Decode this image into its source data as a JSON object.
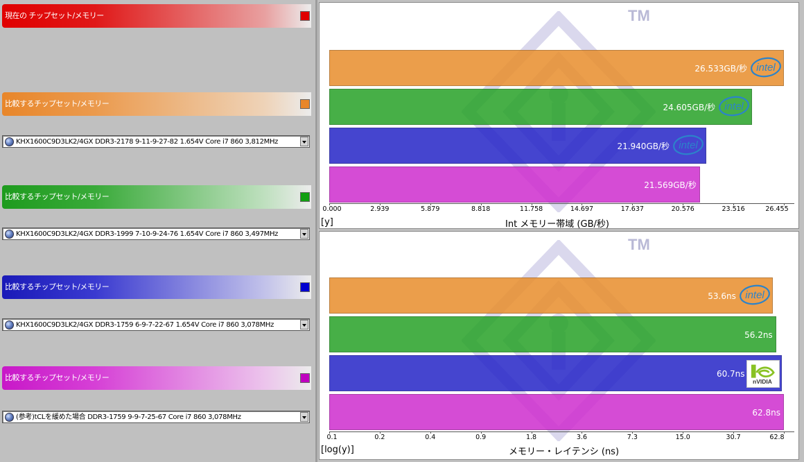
{
  "sidebar": {
    "current_label": "現在の チップセット/メモリー",
    "compare_label": "比較するチップセット/メモリー",
    "slots": [
      {
        "label": "比較するチップセット/メモリー",
        "select_value": "KHX1600C9D3LK2/4GX DDR3-2178 9-11-9-27-82 1.654V Core i7 860 3,812MHz",
        "color": "#e88f2e"
      },
      {
        "label": "比較するチップセット/メモリー",
        "select_value": "KHX1600C9D3LK2/4GX DDR3-1999 7-10-9-24-76 1.654V Core i7 860  3,497MHz",
        "color": "#29a329"
      },
      {
        "label": "比較するチップセット/メモリー",
        "select_value": "KHX1600C9D3LK2/4GX DDR3-1759 6-9-7-22-67 1.654V Core i7 860 3,078MHz",
        "color": "#2727c8"
      },
      {
        "label": "比較するチップセット/メモリー",
        "select_value": "(参考)tCLを緩めた場合  DDR3-1759 9-9-7-25-67 Core i7 860 3,078MHz",
        "color": "#cf2fcf"
      }
    ]
  },
  "watermark": {
    "tm": "TM"
  },
  "chart_data": [
    {
      "type": "bar",
      "orientation": "horizontal",
      "xlabel": "Int メモリー帯域 (GB/秒)",
      "ylabel": "[y]",
      "xlim": [
        0,
        26.455
      ],
      "ticks": [
        "0.000",
        "2.939",
        "5.879",
        "8.818",
        "11.758",
        "14.697",
        "17.637",
        "20.576",
        "23.516",
        "26.455"
      ],
      "values": [
        26.533,
        24.605,
        21.94,
        21.569
      ],
      "value_labels": [
        "26.533GB/秒",
        "24.605GB/秒",
        "21.940GB/秒",
        "21.569GB/秒"
      ],
      "colors": [
        "#e88f2e",
        "#29a329",
        "#2727c8",
        "#cf2fcf"
      ],
      "logos": [
        "intel",
        "intel",
        "intel",
        ""
      ]
    },
    {
      "type": "bar",
      "orientation": "horizontal",
      "xlabel": "メモリー・レイテンシ (ns)",
      "ylabel": "[log(y)]",
      "xscale": "log",
      "xlim": [
        0.1,
        62.8
      ],
      "ticks": [
        "0.1",
        "0.2",
        "0.4",
        "0.9",
        "1.8",
        "3.6",
        "7.3",
        "15.0",
        "30.7",
        "62.8"
      ],
      "values": [
        53.6,
        56.2,
        60.7,
        62.8
      ],
      "value_labels": [
        "53.6ns",
        "56.2ns",
        "60.7ns",
        "62.8ns"
      ],
      "colors": [
        "#e88f2e",
        "#29a329",
        "#2727c8",
        "#cf2fcf"
      ],
      "logos": [
        "intel",
        "",
        "nvidia",
        ""
      ]
    }
  ]
}
